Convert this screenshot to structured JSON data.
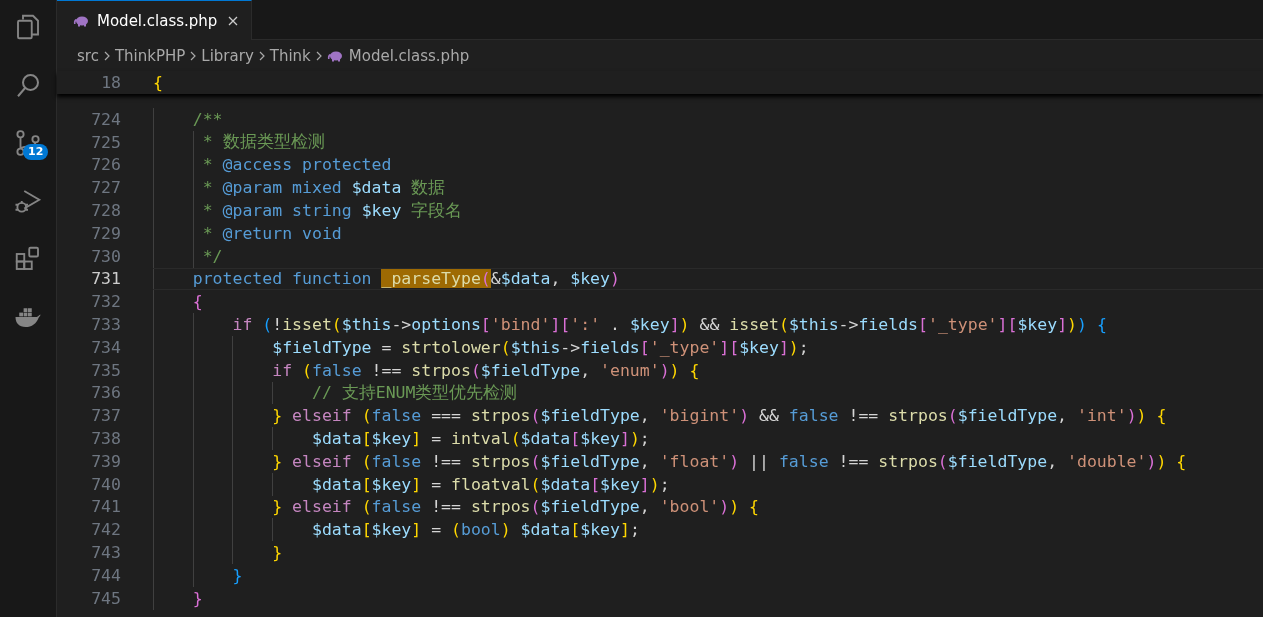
{
  "activity_bar": {
    "items": [
      {
        "kind": "files"
      },
      {
        "kind": "search"
      },
      {
        "kind": "source-control",
        "badge": "12"
      },
      {
        "kind": "run-debug"
      },
      {
        "kind": "extensions"
      },
      {
        "kind": "docker"
      }
    ]
  },
  "tabs": [
    {
      "label": "Model.class.php",
      "selected": true
    }
  ],
  "breadcrumb": [
    {
      "kind": "folder",
      "label": "src"
    },
    {
      "kind": "folder",
      "label": "ThinkPHP"
    },
    {
      "kind": "folder",
      "label": "Library"
    },
    {
      "kind": "folder",
      "label": "Think"
    },
    {
      "kind": "file",
      "label": "Model.class.php"
    }
  ],
  "sticky_line": {
    "number": "18",
    "tokens": [
      {
        "kind": "b1",
        "text": "{"
      }
    ]
  },
  "lines": [
    {
      "number": "724",
      "current": false,
      "tokens": [
        {
          "kind": "cm",
          "text": "    /**"
        }
      ]
    },
    {
      "number": "725",
      "current": false,
      "tokens": [
        {
          "kind": "cm",
          "text": "     * 数据类型检测"
        }
      ]
    },
    {
      "number": "726",
      "current": false,
      "tokens": [
        {
          "kind": "cm",
          "text": "     * "
        },
        {
          "kind": "doc",
          "text": "@access protected"
        }
      ]
    },
    {
      "number": "727",
      "current": false,
      "tokens": [
        {
          "kind": "cm",
          "text": "     * "
        },
        {
          "kind": "doc",
          "text": "@param mixed "
        },
        {
          "kind": "docvar",
          "text": "$data"
        },
        {
          "kind": "cm",
          "text": " 数据"
        }
      ]
    },
    {
      "number": "728",
      "current": false,
      "tokens": [
        {
          "kind": "cm",
          "text": "     * "
        },
        {
          "kind": "doc",
          "text": "@param string "
        },
        {
          "kind": "docvar",
          "text": "$key"
        },
        {
          "kind": "cm",
          "text": " 字段名"
        }
      ]
    },
    {
      "number": "729",
      "current": false,
      "tokens": [
        {
          "kind": "cm",
          "text": "     * "
        },
        {
          "kind": "doc",
          "text": "@return void"
        }
      ]
    },
    {
      "number": "730",
      "current": false,
      "tokens": [
        {
          "kind": "cm",
          "text": "     */"
        }
      ]
    },
    {
      "number": "731",
      "current": true,
      "tokens": [
        {
          "kind": "kw",
          "text": "    protected function "
        },
        {
          "kind": "hl-fn",
          "text": "_parseType"
        },
        {
          "kind": "hl-b2",
          "text": "("
        },
        {
          "kind": "p",
          "text": "&"
        },
        {
          "kind": "var",
          "text": "$data"
        },
        {
          "kind": "p",
          "text": ", "
        },
        {
          "kind": "var",
          "text": "$key"
        },
        {
          "kind": "b2",
          "text": ")"
        }
      ]
    },
    {
      "number": "732",
      "current": false,
      "tokens": [
        {
          "kind": "b2",
          "text": "    {"
        }
      ]
    },
    {
      "number": "733",
      "current": false,
      "tokens": [
        {
          "kind": "ctrl",
          "text": "        if "
        },
        {
          "kind": "b3",
          "text": "("
        },
        {
          "kind": "p",
          "text": "!"
        },
        {
          "kind": "fn",
          "text": "isset"
        },
        {
          "kind": "b1",
          "text": "("
        },
        {
          "kind": "var",
          "text": "$this"
        },
        {
          "kind": "p",
          "text": "->"
        },
        {
          "kind": "var",
          "text": "options"
        },
        {
          "kind": "b2",
          "text": "["
        },
        {
          "kind": "str",
          "text": "'bind'"
        },
        {
          "kind": "b2",
          "text": "]["
        },
        {
          "kind": "str",
          "text": "':'"
        },
        {
          "kind": "p",
          "text": " . "
        },
        {
          "kind": "var",
          "text": "$key"
        },
        {
          "kind": "b2",
          "text": "]"
        },
        {
          "kind": "b1",
          "text": ")"
        },
        {
          "kind": "p",
          "text": " && "
        },
        {
          "kind": "fn",
          "text": "isset"
        },
        {
          "kind": "b1",
          "text": "("
        },
        {
          "kind": "var",
          "text": "$this"
        },
        {
          "kind": "p",
          "text": "->"
        },
        {
          "kind": "var",
          "text": "fields"
        },
        {
          "kind": "b2",
          "text": "["
        },
        {
          "kind": "str",
          "text": "'_type'"
        },
        {
          "kind": "b2",
          "text": "]["
        },
        {
          "kind": "var",
          "text": "$key"
        },
        {
          "kind": "b2",
          "text": "]"
        },
        {
          "kind": "b1",
          "text": ")"
        },
        {
          "kind": "b3",
          "text": ") {"
        }
      ]
    },
    {
      "number": "734",
      "current": false,
      "tokens": [
        {
          "kind": "var",
          "text": "            $fieldType"
        },
        {
          "kind": "p",
          "text": " = "
        },
        {
          "kind": "fn",
          "text": "strtolower"
        },
        {
          "kind": "b1",
          "text": "("
        },
        {
          "kind": "var",
          "text": "$this"
        },
        {
          "kind": "p",
          "text": "->"
        },
        {
          "kind": "var",
          "text": "fields"
        },
        {
          "kind": "b2",
          "text": "["
        },
        {
          "kind": "str",
          "text": "'_type'"
        },
        {
          "kind": "b2",
          "text": "]["
        },
        {
          "kind": "var",
          "text": "$key"
        },
        {
          "kind": "b2",
          "text": "]"
        },
        {
          "kind": "b1",
          "text": ")"
        },
        {
          "kind": "p",
          "text": ";"
        }
      ]
    },
    {
      "number": "735",
      "current": false,
      "tokens": [
        {
          "kind": "ctrl",
          "text": "            if "
        },
        {
          "kind": "b1",
          "text": "("
        },
        {
          "kind": "kw",
          "text": "false"
        },
        {
          "kind": "p",
          "text": " !== "
        },
        {
          "kind": "fn",
          "text": "strpos"
        },
        {
          "kind": "b2",
          "text": "("
        },
        {
          "kind": "var",
          "text": "$fieldType"
        },
        {
          "kind": "p",
          "text": ", "
        },
        {
          "kind": "str",
          "text": "'enum'"
        },
        {
          "kind": "b2",
          "text": ")"
        },
        {
          "kind": "b1",
          "text": ") {"
        }
      ]
    },
    {
      "number": "736",
      "current": false,
      "tokens": [
        {
          "kind": "cm",
          "text": "                // 支持ENUM类型优先检测"
        }
      ]
    },
    {
      "number": "737",
      "current": false,
      "tokens": [
        {
          "kind": "b1",
          "text": "            } "
        },
        {
          "kind": "ctrl",
          "text": "elseif "
        },
        {
          "kind": "b1",
          "text": "("
        },
        {
          "kind": "kw",
          "text": "false"
        },
        {
          "kind": "p",
          "text": " === "
        },
        {
          "kind": "fn",
          "text": "strpos"
        },
        {
          "kind": "b2",
          "text": "("
        },
        {
          "kind": "var",
          "text": "$fieldType"
        },
        {
          "kind": "p",
          "text": ", "
        },
        {
          "kind": "str",
          "text": "'bigint'"
        },
        {
          "kind": "b2",
          "text": ")"
        },
        {
          "kind": "p",
          "text": " && "
        },
        {
          "kind": "kw",
          "text": "false"
        },
        {
          "kind": "p",
          "text": " !== "
        },
        {
          "kind": "fn",
          "text": "strpos"
        },
        {
          "kind": "b2",
          "text": "("
        },
        {
          "kind": "var",
          "text": "$fieldType"
        },
        {
          "kind": "p",
          "text": ", "
        },
        {
          "kind": "str",
          "text": "'int'"
        },
        {
          "kind": "b2",
          "text": ")"
        },
        {
          "kind": "b1",
          "text": ") {"
        }
      ]
    },
    {
      "number": "738",
      "current": false,
      "tokens": [
        {
          "kind": "var",
          "text": "                $data"
        },
        {
          "kind": "b1",
          "text": "["
        },
        {
          "kind": "var",
          "text": "$key"
        },
        {
          "kind": "b1",
          "text": "]"
        },
        {
          "kind": "p",
          "text": " = "
        },
        {
          "kind": "fn",
          "text": "intval"
        },
        {
          "kind": "b1",
          "text": "("
        },
        {
          "kind": "var",
          "text": "$data"
        },
        {
          "kind": "b2",
          "text": "["
        },
        {
          "kind": "var",
          "text": "$key"
        },
        {
          "kind": "b2",
          "text": "]"
        },
        {
          "kind": "b1",
          "text": ")"
        },
        {
          "kind": "p",
          "text": ";"
        }
      ]
    },
    {
      "number": "739",
      "current": false,
      "tokens": [
        {
          "kind": "b1",
          "text": "            } "
        },
        {
          "kind": "ctrl",
          "text": "elseif "
        },
        {
          "kind": "b1",
          "text": "("
        },
        {
          "kind": "kw",
          "text": "false"
        },
        {
          "kind": "p",
          "text": " !== "
        },
        {
          "kind": "fn",
          "text": "strpos"
        },
        {
          "kind": "b2",
          "text": "("
        },
        {
          "kind": "var",
          "text": "$fieldType"
        },
        {
          "kind": "p",
          "text": ", "
        },
        {
          "kind": "str",
          "text": "'float'"
        },
        {
          "kind": "b2",
          "text": ")"
        },
        {
          "kind": "p",
          "text": " || "
        },
        {
          "kind": "kw",
          "text": "false"
        },
        {
          "kind": "p",
          "text": " !== "
        },
        {
          "kind": "fn",
          "text": "strpos"
        },
        {
          "kind": "b2",
          "text": "("
        },
        {
          "kind": "var",
          "text": "$fieldType"
        },
        {
          "kind": "p",
          "text": ", "
        },
        {
          "kind": "str",
          "text": "'double'"
        },
        {
          "kind": "b2",
          "text": ")"
        },
        {
          "kind": "b1",
          "text": ") {"
        }
      ]
    },
    {
      "number": "740",
      "current": false,
      "tokens": [
        {
          "kind": "var",
          "text": "                $data"
        },
        {
          "kind": "b1",
          "text": "["
        },
        {
          "kind": "var",
          "text": "$key"
        },
        {
          "kind": "b1",
          "text": "]"
        },
        {
          "kind": "p",
          "text": " = "
        },
        {
          "kind": "fn",
          "text": "floatval"
        },
        {
          "kind": "b1",
          "text": "("
        },
        {
          "kind": "var",
          "text": "$data"
        },
        {
          "kind": "b2",
          "text": "["
        },
        {
          "kind": "var",
          "text": "$key"
        },
        {
          "kind": "b2",
          "text": "]"
        },
        {
          "kind": "b1",
          "text": ")"
        },
        {
          "kind": "p",
          "text": ";"
        }
      ]
    },
    {
      "number": "741",
      "current": false,
      "tokens": [
        {
          "kind": "b1",
          "text": "            } "
        },
        {
          "kind": "ctrl",
          "text": "elseif "
        },
        {
          "kind": "b1",
          "text": "("
        },
        {
          "kind": "kw",
          "text": "false"
        },
        {
          "kind": "p",
          "text": " !== "
        },
        {
          "kind": "fn",
          "text": "strpos"
        },
        {
          "kind": "b2",
          "text": "("
        },
        {
          "kind": "var",
          "text": "$fieldType"
        },
        {
          "kind": "p",
          "text": ", "
        },
        {
          "kind": "str",
          "text": "'bool'"
        },
        {
          "kind": "b2",
          "text": ")"
        },
        {
          "kind": "b1",
          "text": ") {"
        }
      ]
    },
    {
      "number": "742",
      "current": false,
      "tokens": [
        {
          "kind": "var",
          "text": "                $data"
        },
        {
          "kind": "b1",
          "text": "["
        },
        {
          "kind": "var",
          "text": "$key"
        },
        {
          "kind": "b1",
          "text": "]"
        },
        {
          "kind": "p",
          "text": " = "
        },
        {
          "kind": "b1",
          "text": "("
        },
        {
          "kind": "kw",
          "text": "bool"
        },
        {
          "kind": "b1",
          "text": ")"
        },
        {
          "kind": "var",
          "text": " $data"
        },
        {
          "kind": "b1",
          "text": "["
        },
        {
          "kind": "var",
          "text": "$key"
        },
        {
          "kind": "b1",
          "text": "]"
        },
        {
          "kind": "p",
          "text": ";"
        }
      ]
    },
    {
      "number": "743",
      "current": false,
      "tokens": [
        {
          "kind": "b1",
          "text": "            }"
        }
      ]
    },
    {
      "number": "744",
      "current": false,
      "tokens": [
        {
          "kind": "b3",
          "text": "        }"
        }
      ]
    },
    {
      "number": "745",
      "current": false,
      "tokens": [
        {
          "kind": "b2",
          "text": "    }"
        }
      ]
    }
  ]
}
